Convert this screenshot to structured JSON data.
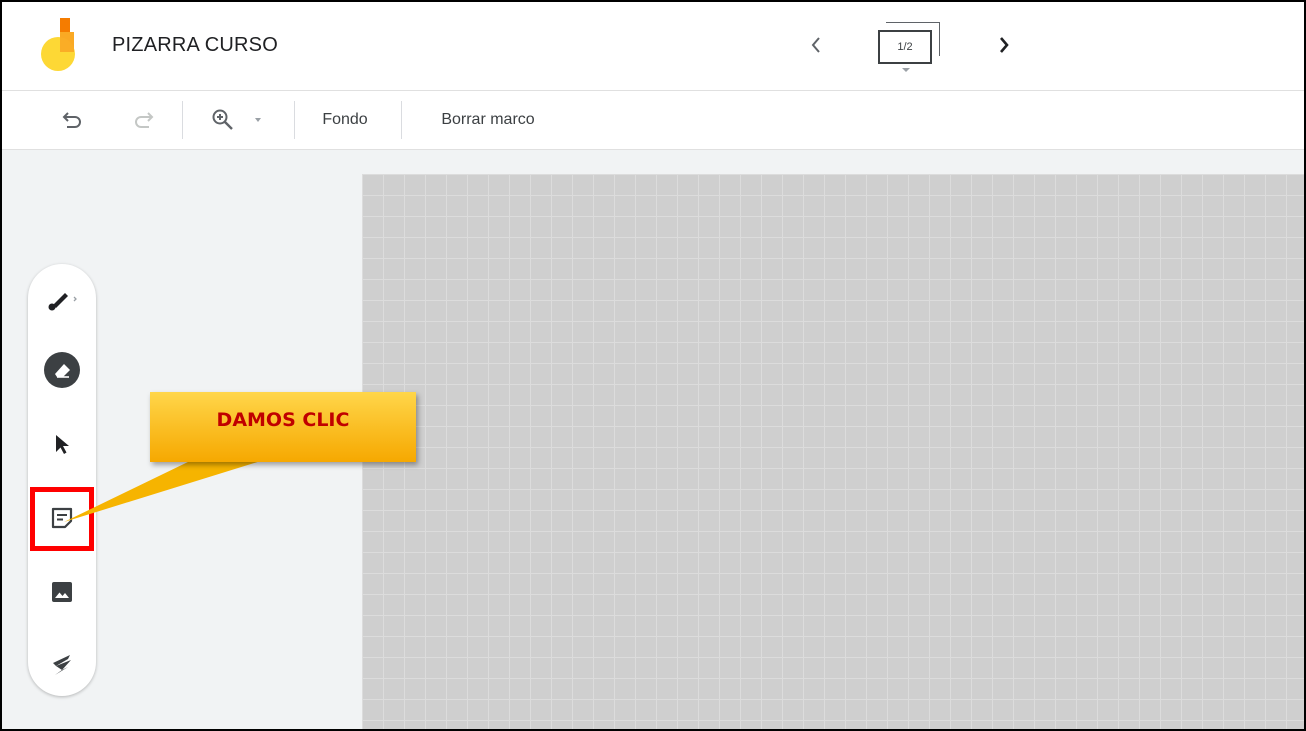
{
  "header": {
    "app_title": "PIZARRA CURSO",
    "frame_indicator": "1/2",
    "prev_icon": "chevron-left-icon",
    "next_icon": "chevron-right-icon"
  },
  "toolbar": {
    "undo_icon": "undo-icon",
    "redo_icon": "redo-icon",
    "zoom_icon": "zoom-in-icon",
    "background_label": "Fondo",
    "clear_frame_label": "Borrar marco"
  },
  "tools": [
    {
      "name": "pen",
      "icon": "brush-icon"
    },
    {
      "name": "eraser",
      "icon": "eraser-icon",
      "selected": true
    },
    {
      "name": "select",
      "icon": "cursor-icon"
    },
    {
      "name": "sticky-note",
      "icon": "sticky-note-icon",
      "highlighted": true
    },
    {
      "name": "image",
      "icon": "image-icon"
    },
    {
      "name": "laser",
      "icon": "laser-icon"
    }
  ],
  "annotation": {
    "callout_text": "DAMOS CLIC",
    "callout_color": "#f6b400",
    "callout_text_color": "#c00000",
    "highlight_color": "#ff0000"
  },
  "colors": {
    "canvas_bg": "#cfcfcf",
    "grid_line": "#dcdcdc",
    "workspace_bg": "#f1f3f4"
  }
}
